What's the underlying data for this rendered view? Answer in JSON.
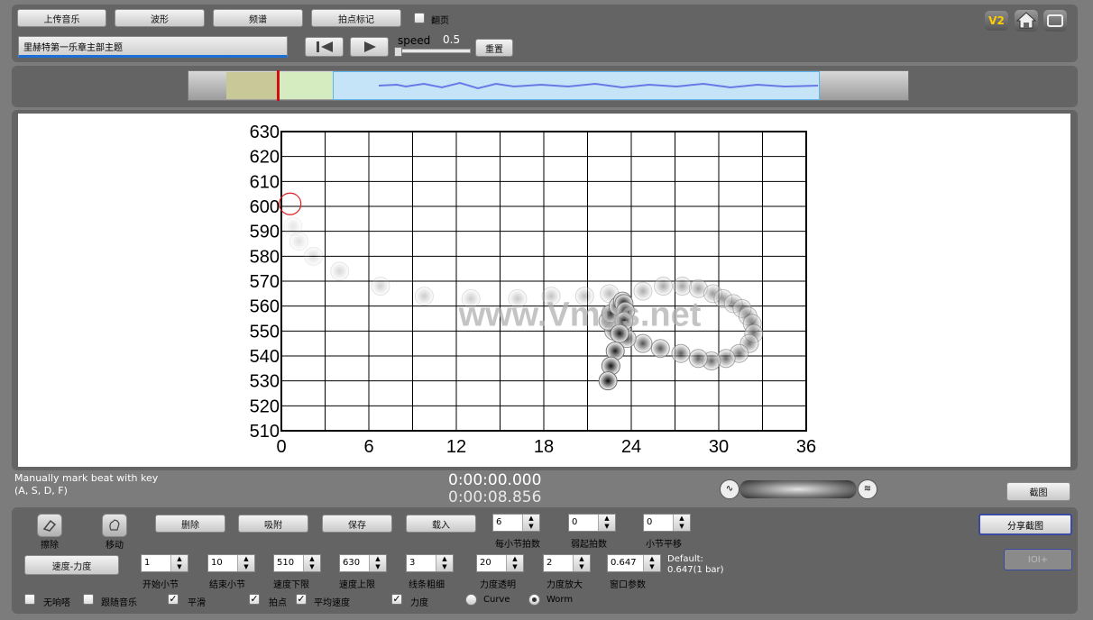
{
  "toolbar": {
    "upload": "上传音乐",
    "waveform": "波形",
    "spectrum": "频谱",
    "beat_mark": "拍点标记",
    "flip_page": "翻页",
    "title_value": "里赫特第一乐章主部主题",
    "speed_label": "speed",
    "speed_value": "0.5",
    "reset": "重置",
    "v2_badge": "V2"
  },
  "chart_data": {
    "type": "scatter",
    "x_ticks": [
      "0",
      "6",
      "12",
      "18",
      "24",
      "30",
      "36"
    ],
    "y_ticks": [
      "630",
      "620",
      "610",
      "600",
      "590",
      "580",
      "570",
      "560",
      "550",
      "540",
      "530",
      "520",
      "510"
    ],
    "xlim": [
      0,
      36
    ],
    "ylim": [
      510,
      630
    ],
    "grid": true,
    "watermark": "www.Vmus.net",
    "cursor": {
      "x": 0.6,
      "y": 601
    },
    "points": [
      {
        "x": 0.8,
        "y": 592,
        "o": 0.1
      },
      {
        "x": 1.2,
        "y": 586,
        "o": 0.12
      },
      {
        "x": 2.2,
        "y": 580,
        "o": 0.14
      },
      {
        "x": 4.0,
        "y": 574,
        "o": 0.16
      },
      {
        "x": 6.8,
        "y": 568,
        "o": 0.18
      },
      {
        "x": 9.8,
        "y": 564,
        "o": 0.2
      },
      {
        "x": 13.0,
        "y": 563,
        "o": 0.2
      },
      {
        "x": 16.2,
        "y": 563,
        "o": 0.22
      },
      {
        "x": 18.5,
        "y": 564,
        "o": 0.24
      },
      {
        "x": 20.8,
        "y": 564,
        "o": 0.26
      },
      {
        "x": 22.5,
        "y": 565,
        "o": 0.28
      },
      {
        "x": 24.8,
        "y": 566,
        "o": 0.32
      },
      {
        "x": 26.2,
        "y": 568,
        "o": 0.34
      },
      {
        "x": 27.5,
        "y": 568,
        "o": 0.36
      },
      {
        "x": 28.6,
        "y": 567,
        "o": 0.38
      },
      {
        "x": 29.6,
        "y": 565,
        "o": 0.4
      },
      {
        "x": 30.3,
        "y": 563,
        "o": 0.42
      },
      {
        "x": 31.0,
        "y": 561,
        "o": 0.44
      },
      {
        "x": 31.6,
        "y": 559,
        "o": 0.46
      },
      {
        "x": 32.0,
        "y": 556,
        "o": 0.48
      },
      {
        "x": 32.3,
        "y": 553,
        "o": 0.5
      },
      {
        "x": 32.4,
        "y": 549,
        "o": 0.52
      },
      {
        "x": 32.1,
        "y": 545,
        "o": 0.54
      },
      {
        "x": 31.4,
        "y": 541,
        "o": 0.56
      },
      {
        "x": 30.5,
        "y": 539,
        "o": 0.58
      },
      {
        "x": 29.5,
        "y": 538,
        "o": 0.6
      },
      {
        "x": 28.6,
        "y": 539,
        "o": 0.62
      },
      {
        "x": 27.4,
        "y": 541,
        "o": 0.64
      },
      {
        "x": 26.0,
        "y": 543,
        "o": 0.66
      },
      {
        "x": 24.8,
        "y": 545,
        "o": 0.68
      },
      {
        "x": 23.7,
        "y": 547,
        "o": 0.7
      },
      {
        "x": 22.8,
        "y": 550,
        "o": 0.72
      },
      {
        "x": 22.4,
        "y": 554,
        "o": 0.74
      },
      {
        "x": 22.6,
        "y": 557,
        "o": 0.76
      },
      {
        "x": 23.1,
        "y": 560,
        "o": 0.78
      },
      {
        "x": 23.4,
        "y": 562,
        "o": 0.8
      },
      {
        "x": 23.5,
        "y": 561,
        "o": 0.82
      },
      {
        "x": 23.6,
        "y": 558,
        "o": 0.84
      },
      {
        "x": 23.5,
        "y": 554,
        "o": 0.86
      },
      {
        "x": 23.2,
        "y": 549,
        "o": 0.88
      },
      {
        "x": 22.9,
        "y": 542,
        "o": 0.9
      },
      {
        "x": 22.6,
        "y": 536,
        "o": 0.93
      },
      {
        "x": 22.4,
        "y": 530,
        "o": 0.96
      }
    ]
  },
  "status": {
    "hint_line1": "Manually mark beat with key",
    "hint_line2": "(A, S, D, F)",
    "time_current": "0:00:00.000",
    "time_total": "0:00:08.856",
    "screenshot": "截图",
    "share_screenshot": "分享截图",
    "ioi_button": "IOI+"
  },
  "controls": {
    "erase": "擦除",
    "move": "移动",
    "delete": "删除",
    "snap": "吸附",
    "save": "保存",
    "load": "载入",
    "tempo_dynamics": "速度-力度",
    "beats_per_bar": {
      "label": "每小节拍数",
      "value": "6"
    },
    "pickup_beats": {
      "label": "弱起拍数",
      "value": "0"
    },
    "bar_offset": {
      "label": "小节平移",
      "value": "0"
    },
    "start_bar": {
      "label": "开始小节",
      "value": "1"
    },
    "end_bar": {
      "label": "结束小节",
      "value": "10"
    },
    "tempo_min": {
      "label": "速度下限",
      "value": "510"
    },
    "tempo_max": {
      "label": "速度上限",
      "value": "630"
    },
    "line_width": {
      "label": "线条粗细",
      "value": "3"
    },
    "dyn_opacity": {
      "label": "力度透明",
      "value": "20"
    },
    "dyn_scale": {
      "label": "力度放大",
      "value": "2"
    },
    "window_param": {
      "label": "窗口参数",
      "value": "0.647"
    },
    "default_label": "Default:",
    "default_value": "0.647(1 bar)",
    "no_metronome": "无响嗒",
    "follow_music": "跟随音乐",
    "smooth": "平滑",
    "beat_points": "拍点",
    "avg_tempo": "平均速度",
    "dynamics": "力度",
    "curve": "Curve",
    "worm": "Worm"
  }
}
